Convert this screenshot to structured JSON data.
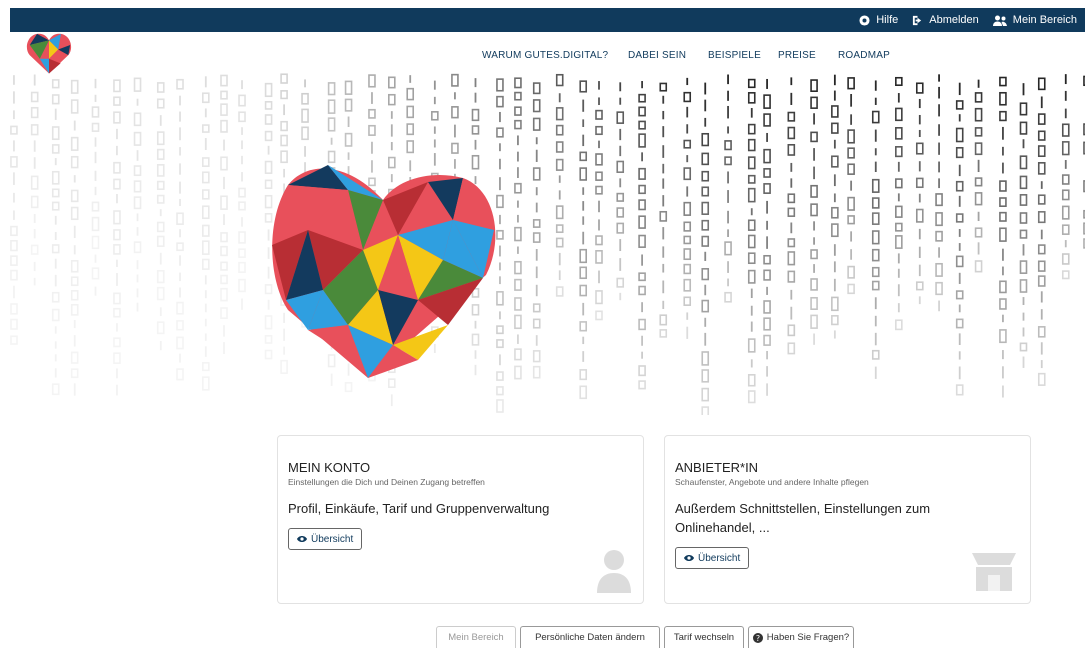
{
  "topbar": {
    "help": "Hilfe",
    "logout": "Abmelden",
    "my_area": "Mein Bereich"
  },
  "nav": {
    "items": [
      "WARUM GUTES.DIGITAL?",
      "DABEI SEIN",
      "BEISPIELE",
      "PREISE",
      "ROADMAP"
    ]
  },
  "cards": [
    {
      "title": "MEIN KONTO",
      "subtitle": "Einstellungen die Dich und Deinen Zugang betreffen",
      "description": "Profil, Einkäufe, Tarif und Gruppenverwaltung",
      "button": "Übersicht",
      "icon": "user-icon"
    },
    {
      "title": "ANBIETER*IN",
      "subtitle": "Schaufenster, Angebote und andere Inhalte pflegen",
      "description": "Außerdem Schnittstellen, Einstellungen zum Onlinehandel, ...",
      "button": "Übersicht",
      "icon": "store-icon"
    }
  ],
  "footer_links": [
    "Mein Bereich",
    "Persönliche Daten ändern",
    "Tarif wechseln",
    "Haben Sie Fragen?"
  ],
  "colors": {
    "topbar": "#103a5c",
    "heart_red": "#e8505b",
    "heart_blue": "#2f9fe0",
    "heart_green": "#4a8a3a",
    "heart_yellow": "#f4c716",
    "heart_navy": "#133a5e",
    "heart_darkred": "#b82e34"
  }
}
